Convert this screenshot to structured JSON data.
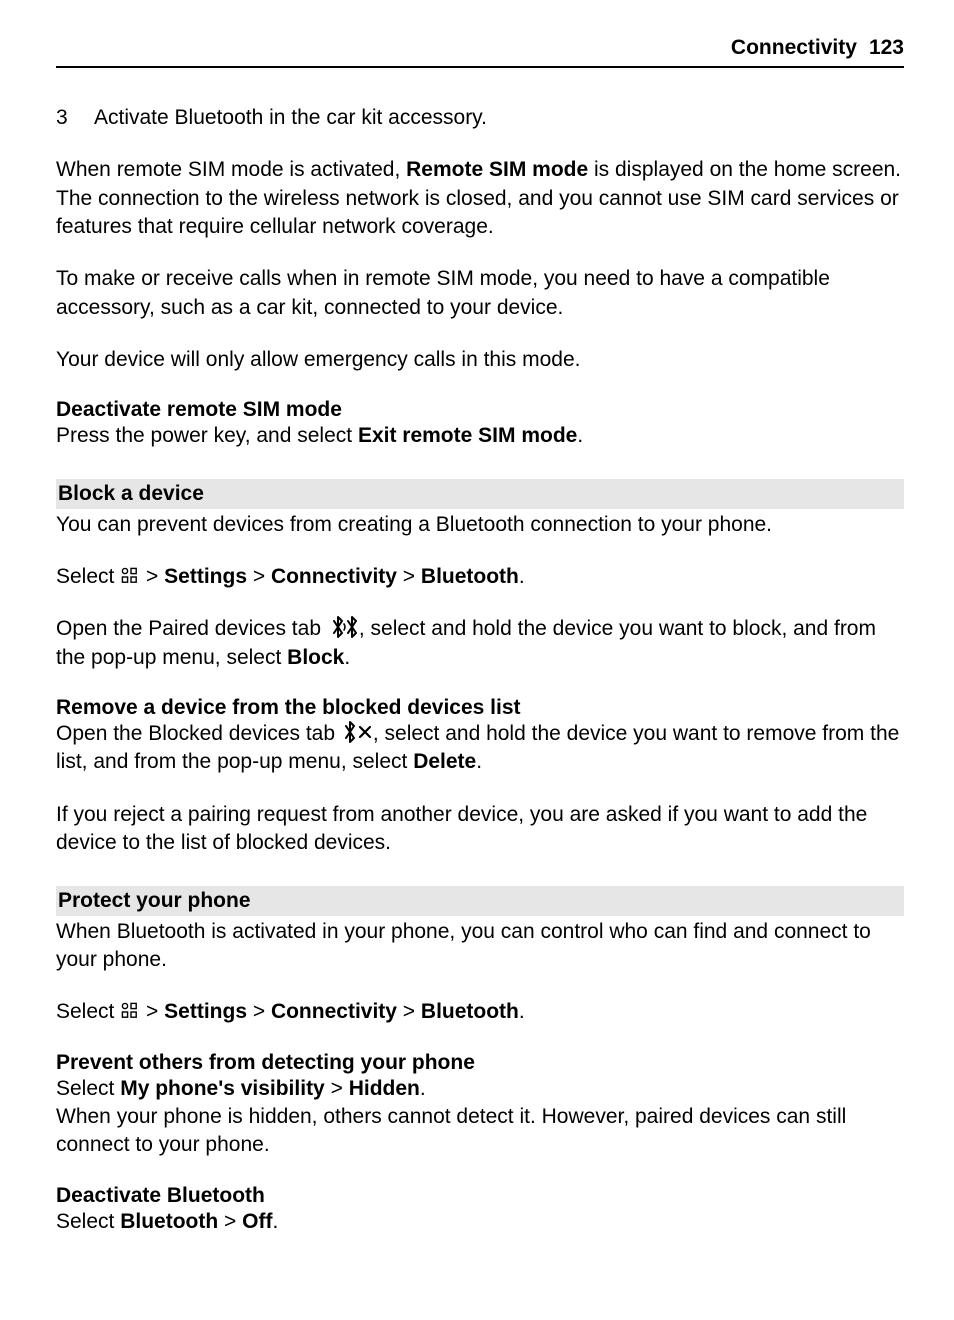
{
  "runhead": {
    "title": "Connectivity",
    "page": "123"
  },
  "step3": {
    "num": "3",
    "text": "Activate Bluetooth in the car kit accessory."
  },
  "p_remote_sim": {
    "a": "When remote SIM mode is activated, ",
    "b": "Remote SIM mode",
    "c": " is displayed on the home screen. The connection to the wireless network is closed, and you cannot use SIM card services or features that require cellular network coverage."
  },
  "p_calls": "To make or receive calls when in remote SIM mode, you need to have a compatible accessory, such as a car kit, connected to your device.",
  "p_emergency": "Your device will only allow emergency calls in this mode.",
  "sub_deact_sim": "Deactivate remote SIM mode",
  "p_deact_sim": {
    "a": "Press the power key, and select ",
    "b": "Exit remote SIM mode",
    "c": "."
  },
  "bar_block": "Block a device",
  "p_block_intro": "You can prevent devices from creating a Bluetooth connection to your phone.",
  "nav": {
    "select": "Select ",
    "gt1": " > ",
    "settings": "Settings",
    "gt2": " > ",
    "connectivity": "Connectivity",
    "gt3": " > ",
    "bluetooth": "Bluetooth",
    "dot": "."
  },
  "p_paired": {
    "a": "Open the Paired devices tab ",
    "b": ", select and hold the device you want to block, and from the pop-up menu, select ",
    "c": "Block",
    "d": "."
  },
  "sub_remove": "Remove a device from the blocked devices list",
  "p_blocked": {
    "a": "Open the Blocked devices tab ",
    "b": ", select and hold the device you want to remove from the list, and from the pop-up menu, select ",
    "c": "Delete",
    "d": "."
  },
  "p_reject": "If you reject a pairing request from another device, you are asked if you want to add the device to the list of blocked devices.",
  "bar_protect": "Protect your phone",
  "p_protect_intro": "When Bluetooth is activated in your phone, you can control who can find and connect to your phone.",
  "sub_prevent": "Prevent others from detecting your phone",
  "p_visibility": {
    "a": "Select ",
    "b": "My phone's visibility",
    "c": " > ",
    "d": "Hidden",
    "e": "."
  },
  "p_hidden_note": "When your phone is hidden, others cannot detect it. However, paired devices can still connect to your phone.",
  "sub_deact_bt": "Deactivate Bluetooth",
  "p_deact_bt": {
    "a": "Select ",
    "b": "Bluetooth",
    "c": " > ",
    "d": "Off",
    "e": "."
  }
}
